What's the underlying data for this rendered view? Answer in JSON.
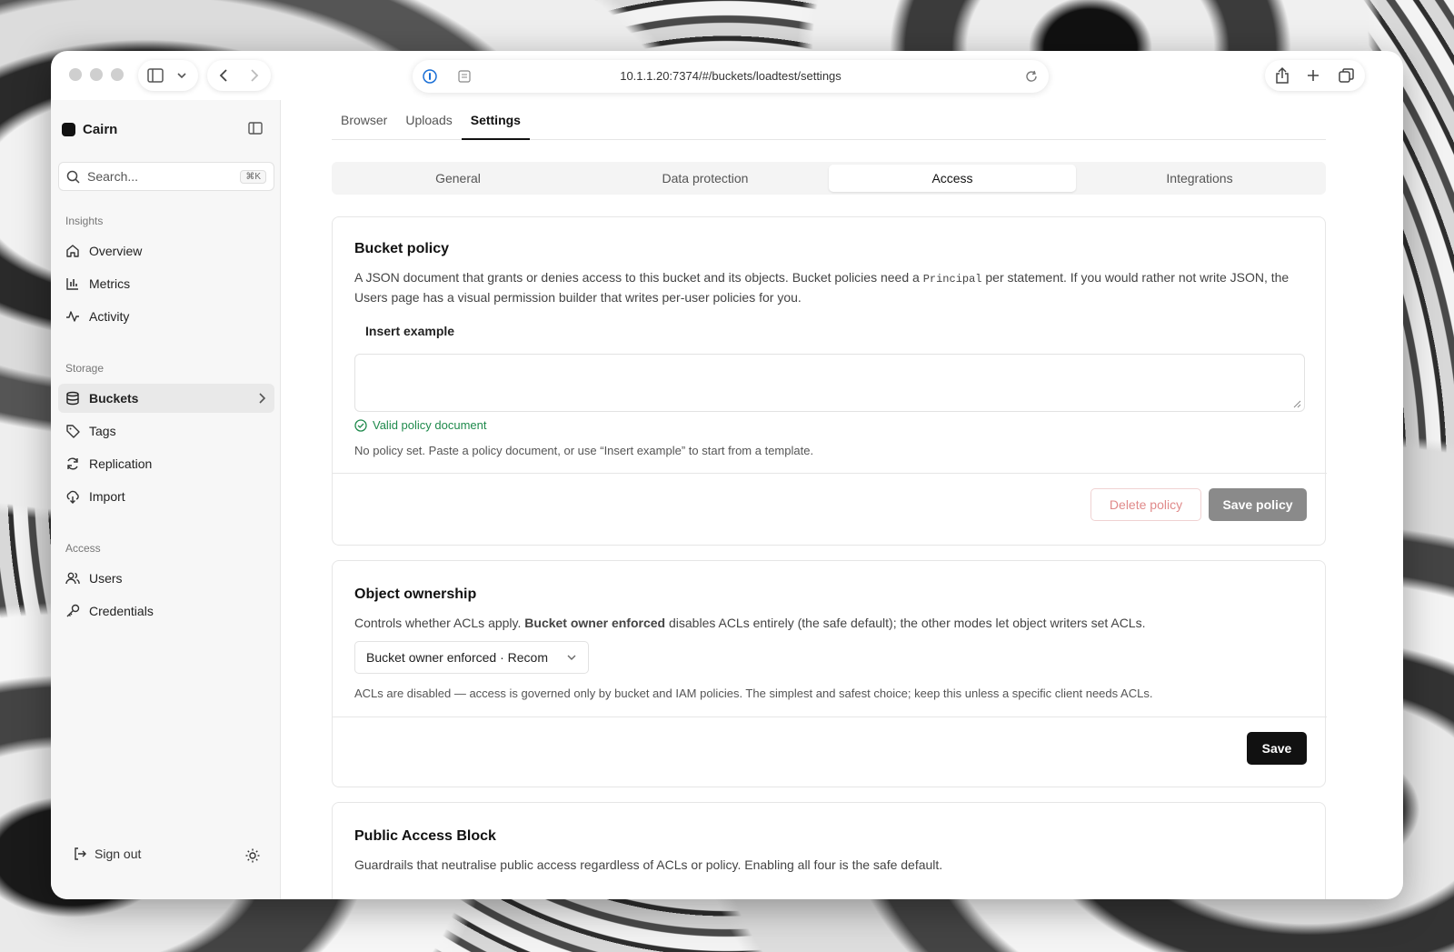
{
  "browser": {
    "url": "10.1.1.20:7374/#/buckets/loadtest/settings"
  },
  "sidebar": {
    "brand": "Cairn",
    "search_placeholder": "Search...",
    "search_shortcut": "⌘K",
    "groups": [
      {
        "label": "Insights",
        "items": [
          {
            "label": "Overview",
            "icon": "home-icon"
          },
          {
            "label": "Metrics",
            "icon": "bar-chart-icon"
          },
          {
            "label": "Activity",
            "icon": "activity-icon"
          }
        ]
      },
      {
        "label": "Storage",
        "items": [
          {
            "label": "Buckets",
            "icon": "database-icon",
            "active": true
          },
          {
            "label": "Tags",
            "icon": "tag-icon"
          },
          {
            "label": "Replication",
            "icon": "refresh-icon"
          },
          {
            "label": "Import",
            "icon": "cloud-download-icon"
          }
        ]
      },
      {
        "label": "Access",
        "items": [
          {
            "label": "Users",
            "icon": "users-icon"
          },
          {
            "label": "Credentials",
            "icon": "key-icon"
          }
        ]
      }
    ],
    "sign_out": "Sign out"
  },
  "tabs": [
    "Browser",
    "Uploads",
    "Settings"
  ],
  "active_tab": "Settings",
  "segments": [
    "General",
    "Data protection",
    "Access",
    "Integrations"
  ],
  "active_segment": "Access",
  "bucket_policy": {
    "title": "Bucket policy",
    "desc_1": "A JSON document that grants or denies access to this bucket and its objects. Bucket policies need a",
    "desc_code": "Principal",
    "desc_2": "per statement. If you would rather not write JSON, the Users page has a visual permission builder that writes per-user policies for you.",
    "insert_example": "Insert example",
    "policy_text": "",
    "valid_text": "Valid policy document",
    "hint": "No policy set. Paste a policy document, or use “Insert example” to start from a template.",
    "delete_label": "Delete policy",
    "save_label": "Save policy"
  },
  "object_ownership": {
    "title": "Object ownership",
    "desc_1": "Controls whether ACLs apply.",
    "desc_bold": "Bucket owner enforced",
    "desc_2": "disables ACLs entirely (the safe default); the other modes let object writers set ACLs.",
    "selected": "Bucket owner enforced · Recom",
    "hint": "ACLs are disabled — access is governed only by bucket and IAM policies. The simplest and safest choice; keep this unless a specific client needs ACLs.",
    "save_label": "Save"
  },
  "public_access_block": {
    "title": "Public Access Block",
    "desc": "Guardrails that neutralise public access regardless of ACLs or policy. Enabling all four is the safe default."
  },
  "colors": {
    "accent": "#111111",
    "success": "#1f8a4c",
    "danger": "#e08a8a"
  }
}
